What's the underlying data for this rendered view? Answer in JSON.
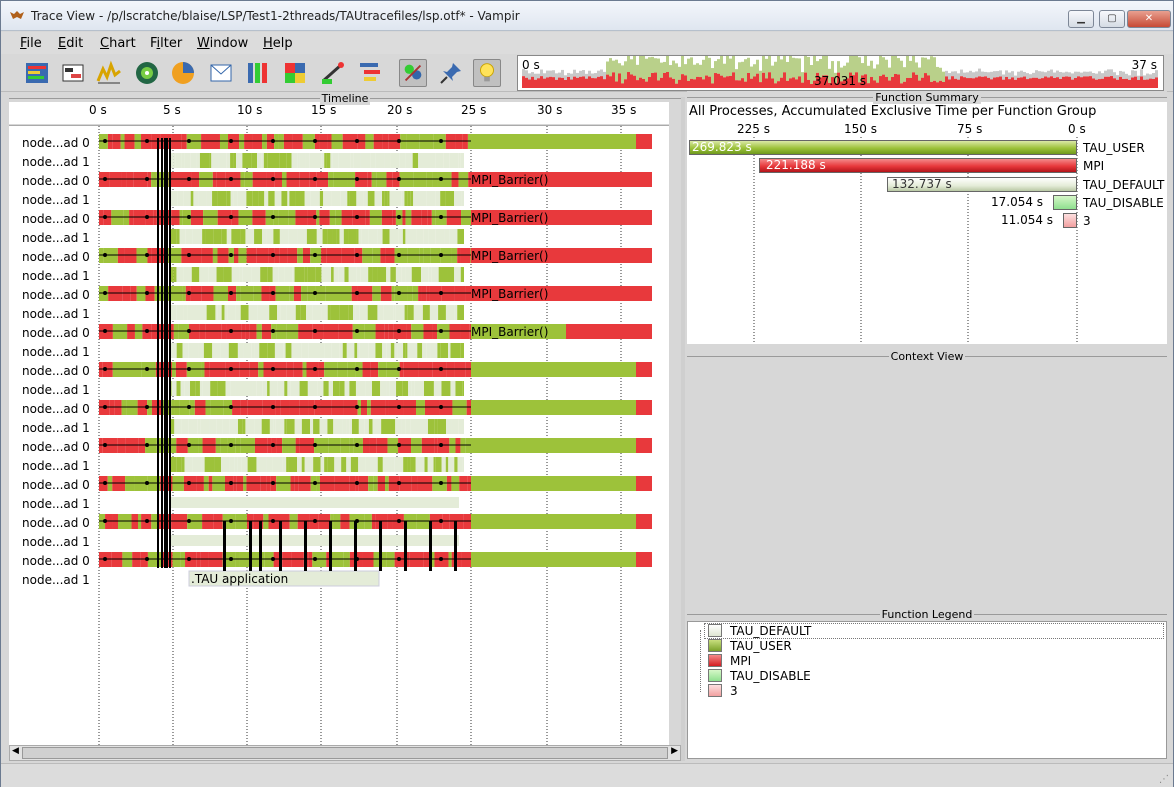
{
  "window": {
    "title": "Trace View - /p/lscratche/blaise/LSP/Test1-2threads/TAUtracefiles/lsp.otf* - Vampir",
    "icon": "vampir-bat-icon"
  },
  "menu": {
    "items": [
      {
        "label": "File",
        "mnemonic": "F"
      },
      {
        "label": "Edit",
        "mnemonic": "E"
      },
      {
        "label": "Chart",
        "mnemonic": "C"
      },
      {
        "label": "Filter",
        "mnemonic": "i"
      },
      {
        "label": "Window",
        "mnemonic": "W"
      },
      {
        "label": "Help",
        "mnemonic": "H"
      }
    ]
  },
  "toolbar": {
    "icons": [
      "master-timeline-icon",
      "process-timeline-icon",
      "counter-timeline-icon",
      "performance-radar-icon",
      "function-summary-icon",
      "message-summary-icon",
      "process-summary-icon",
      "communication-matrix-icon",
      "io-events-icon",
      "call-tree-icon",
      "filter-icon",
      "pin-icon",
      "lightbulb-icon"
    ]
  },
  "overview": {
    "start_label": "0 s",
    "end_label": "37 s",
    "center_label": "37.031 s"
  },
  "timeline": {
    "section_title": "Timeline",
    "ticks": [
      "0 s",
      "5 s",
      "10 s",
      "15 s",
      "20 s",
      "25 s",
      "30 s",
      "35 s"
    ],
    "processes": [
      "node...ad 0",
      "node...ad 1",
      "node...ad 0",
      "node...ad 1",
      "node...ad 0",
      "node...ad 1",
      "node...ad 0",
      "node...ad 1",
      "node...ad 0",
      "node...ad 1",
      "node...ad 0",
      "node...ad 1",
      "node...ad 0",
      "node...ad 1",
      "node...ad 0",
      "node...ad 1",
      "node...ad 0",
      "node...ad 1",
      "node...ad 0",
      "node...ad 1",
      "node...ad 0",
      "node...ad 1",
      "node...ad 0",
      "node...ad 1",
      "node...ad 0",
      "node...ad 1"
    ],
    "annotations": {
      "barrier_label": "MPI_Barrier()",
      "app_label": ".TAU application"
    }
  },
  "function_summary": {
    "section_title": "Function Summary",
    "heading": "All Processes, Accumulated Exclusive Time per Function Group",
    "axis_ticks": [
      "225 s",
      "150 s",
      "75 s",
      "0 s"
    ],
    "rows": [
      {
        "name": "TAU_USER",
        "value": "269.823 s"
      },
      {
        "name": "MPI",
        "value": "221.188 s"
      },
      {
        "name": "TAU_DEFAULT",
        "value": "132.737 s"
      },
      {
        "name": "TAU_DISABLE",
        "value": "17.054 s"
      },
      {
        "name": "3",
        "value": "11.054 s"
      }
    ]
  },
  "context_view": {
    "section_title": "Context View"
  },
  "function_legend": {
    "section_title": "Function Legend",
    "items": [
      {
        "label": "TAU_DEFAULT"
      },
      {
        "label": "TAU_USER"
      },
      {
        "label": "MPI"
      },
      {
        "label": "TAU_DISABLE"
      },
      {
        "label": "3"
      }
    ]
  },
  "colors": {
    "tau_user": "#9dc23a",
    "mpi": "#e8393c",
    "tau_default": "#e4ecd8",
    "tau_disable": "#8fe08f",
    "group3": "#f2a0a0"
  }
}
